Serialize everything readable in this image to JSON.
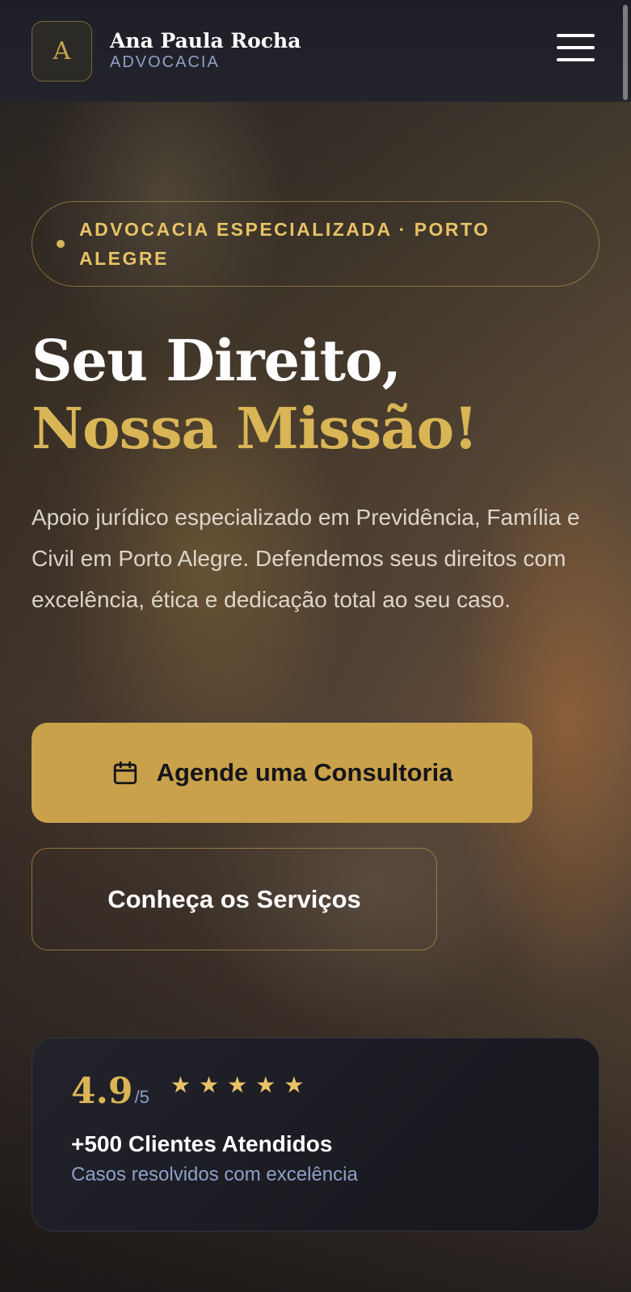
{
  "header": {
    "logo_letter": "A",
    "brand_name": "Ana Paula Rocha",
    "brand_sub": "ADVOCACIA"
  },
  "hero": {
    "badge": "ADVOCACIA ESPECIALIZADA · PORTO ALEGRE",
    "headline_line1": "Seu Direito,",
    "headline_line2": "Nossa Missão!",
    "description": "Apoio jurídico especializado em Previdência, Família e Civil em Porto Alegre. Defendemos seus direitos com excelência, ética e dedicação total ao seu caso.",
    "primary_button": "Agende uma Consultoria",
    "secondary_button": "Conheça os Serviços"
  },
  "rating_card": {
    "rating": "4.9",
    "rating_max": "/5",
    "stars": 5,
    "title": "+500 Clientes Atendidos",
    "subtitle": "Casos resolvidos com excelência"
  },
  "colors": {
    "accent_gold": "#c9a14a",
    "text_gold": "#d9b556",
    "muted_blue": "#8fa0c8",
    "header_bg": "#1e1e26"
  },
  "icons": {
    "menu": "hamburger-menu-icon",
    "calendar": "calendar-icon",
    "star": "star-icon"
  }
}
